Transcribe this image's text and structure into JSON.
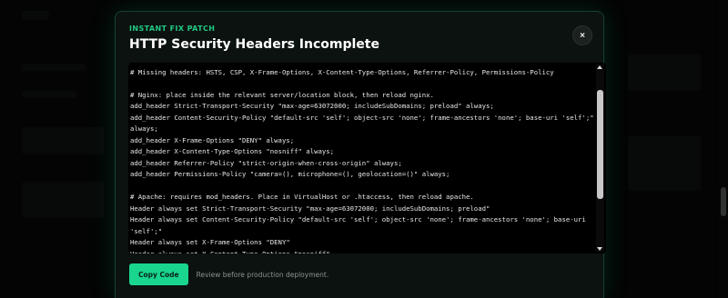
{
  "modal": {
    "kicker": "INSTANT FIX PATCH",
    "title": "HTTP Security Headers Incomplete",
    "close_label": "×"
  },
  "code": {
    "lines": [
      "",
      "# Missing headers: HSTS, CSP, X-Frame-Options, X-Content-Type-Options, Referrer-Policy, Permissions-Policy",
      "",
      "# Nginx: place inside the relevant server/location block, then reload nginx.",
      "add_header Strict-Transport-Security \"max-age=63072000; includeSubDomains; preload\" always;",
      "add_header Content-Security-Policy \"default-src 'self'; object-src 'none'; frame-ancestors 'none'; base-uri 'self';\"",
      "always;",
      "add_header X-Frame-Options \"DENY\" always;",
      "add_header X-Content-Type-Options \"nosniff\" always;",
      "add_header Referrer-Policy \"strict-origin-when-cross-origin\" always;",
      "add_header Permissions-Policy \"camera=(), microphone=(), geolocation=()\" always;",
      "",
      "# Apache: requires mod_headers. Place in VirtualHost or .htaccess, then reload apache.",
      "Header always set Strict-Transport-Security \"max-age=63072000; includeSubDomains; preload\"",
      "Header always set Content-Security-Policy \"default-src 'self'; object-src 'none'; frame-ancestors 'none'; base-uri",
      "'self';\"",
      "Header always set X-Frame-Options \"DENY\"",
      "Header always set X-Content-Type-Options \"nosniff\""
    ]
  },
  "footer": {
    "copy_label": "Copy Code",
    "note": "Review before production deployment."
  },
  "colors": {
    "accent": "#19d58d",
    "kicker": "#22c983",
    "modal_border": "#16412e"
  }
}
